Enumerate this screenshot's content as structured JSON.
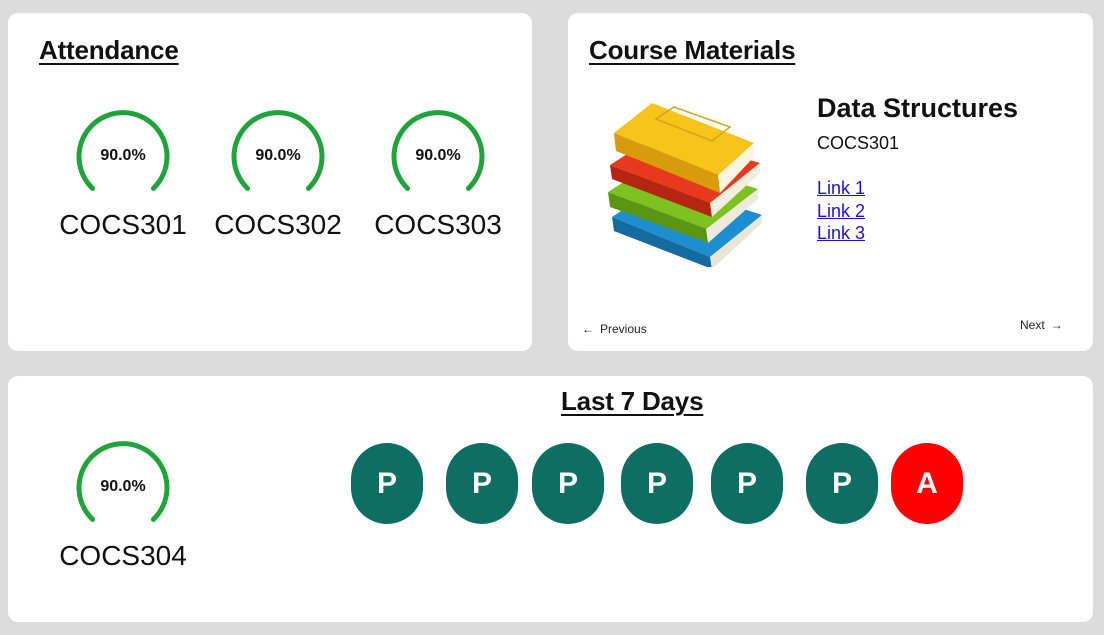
{
  "attendance": {
    "title": "Attendance",
    "courses": [
      {
        "percent_label": "90.0%",
        "percent": 90.0,
        "code": "COCS301"
      },
      {
        "percent_label": "90.0%",
        "percent": 90.0,
        "code": "COCS302"
      },
      {
        "percent_label": "90.0%",
        "percent": 90.0,
        "code": "COCS303"
      }
    ]
  },
  "materials": {
    "title": "Course Materials",
    "image_icon": "stack-of-books-icon",
    "course_name": "Data Structures",
    "course_code": "COCS301",
    "links": [
      "Link 1",
      "Link 2",
      "Link 3"
    ],
    "previous_label": "Previous",
    "next_label": "Next"
  },
  "last7": {
    "title": "Last 7 Days",
    "course": {
      "percent_label": "90.0%",
      "percent": 90.0,
      "code": "COCS304"
    },
    "days": [
      "P",
      "P",
      "P",
      "P",
      "P",
      "P",
      "A"
    ]
  },
  "colors": {
    "gauge": "#1fa33a",
    "present": "#0e6e62",
    "absent": "#ff0000",
    "link": "#1a12d9",
    "background": "#dcdcdc"
  }
}
